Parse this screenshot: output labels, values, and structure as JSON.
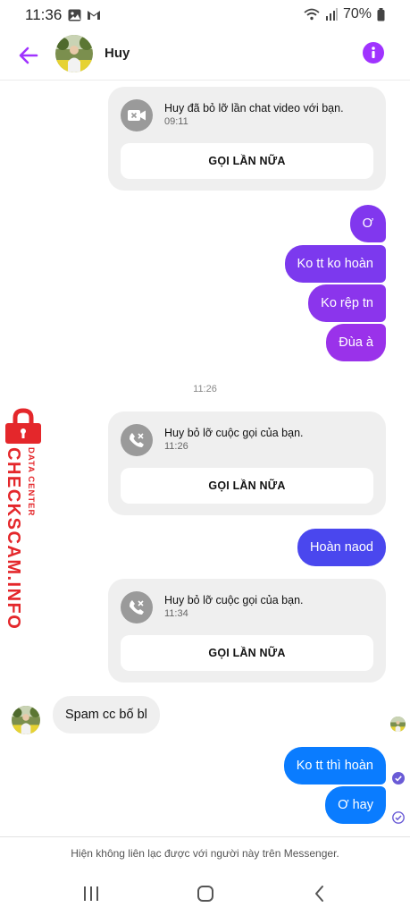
{
  "status_bar": {
    "time": "11:36",
    "battery": "70%"
  },
  "header": {
    "name": "Huy"
  },
  "cards": [
    {
      "title": "Huy đã bỏ lỡ lần chat video với bạn.",
      "time": "09:11",
      "button": "GỌI LẦN NỮA",
      "icon": "video-missed-icon"
    },
    {
      "title": "Huy bỏ lỡ cuộc gọi của bạn.",
      "time": "11:26",
      "button": "GỌI LẦN NỮA",
      "icon": "phone-missed-icon"
    },
    {
      "title": "Huy bỏ lỡ cuộc gọi của bạn.",
      "time": "11:34",
      "button": "GỌI LẦN NỮA",
      "icon": "phone-missed-icon"
    }
  ],
  "messages": {
    "out1": "Ơ",
    "out2": "Ko tt ko hoàn",
    "out3": "Ko rệp tn",
    "out4": "Đùa à",
    "out5": "Hoàn naod",
    "in1": "Spam cc bố bl",
    "out6": "Ko tt thì hoàn",
    "out7": "Ơ hay"
  },
  "time_separator": "11:26",
  "watermark": {
    "main": "CHECKSCAM.INFO",
    "sub": "DATA CENTER"
  },
  "footer": {
    "notice": "Hiện không liên lạc được với người này trên Messenger."
  },
  "colors": {
    "accent": "#a033ff",
    "bubble_purple": "#8a2be2",
    "bubble_blue": "#0a7cff",
    "watermark": "#e4272b"
  }
}
